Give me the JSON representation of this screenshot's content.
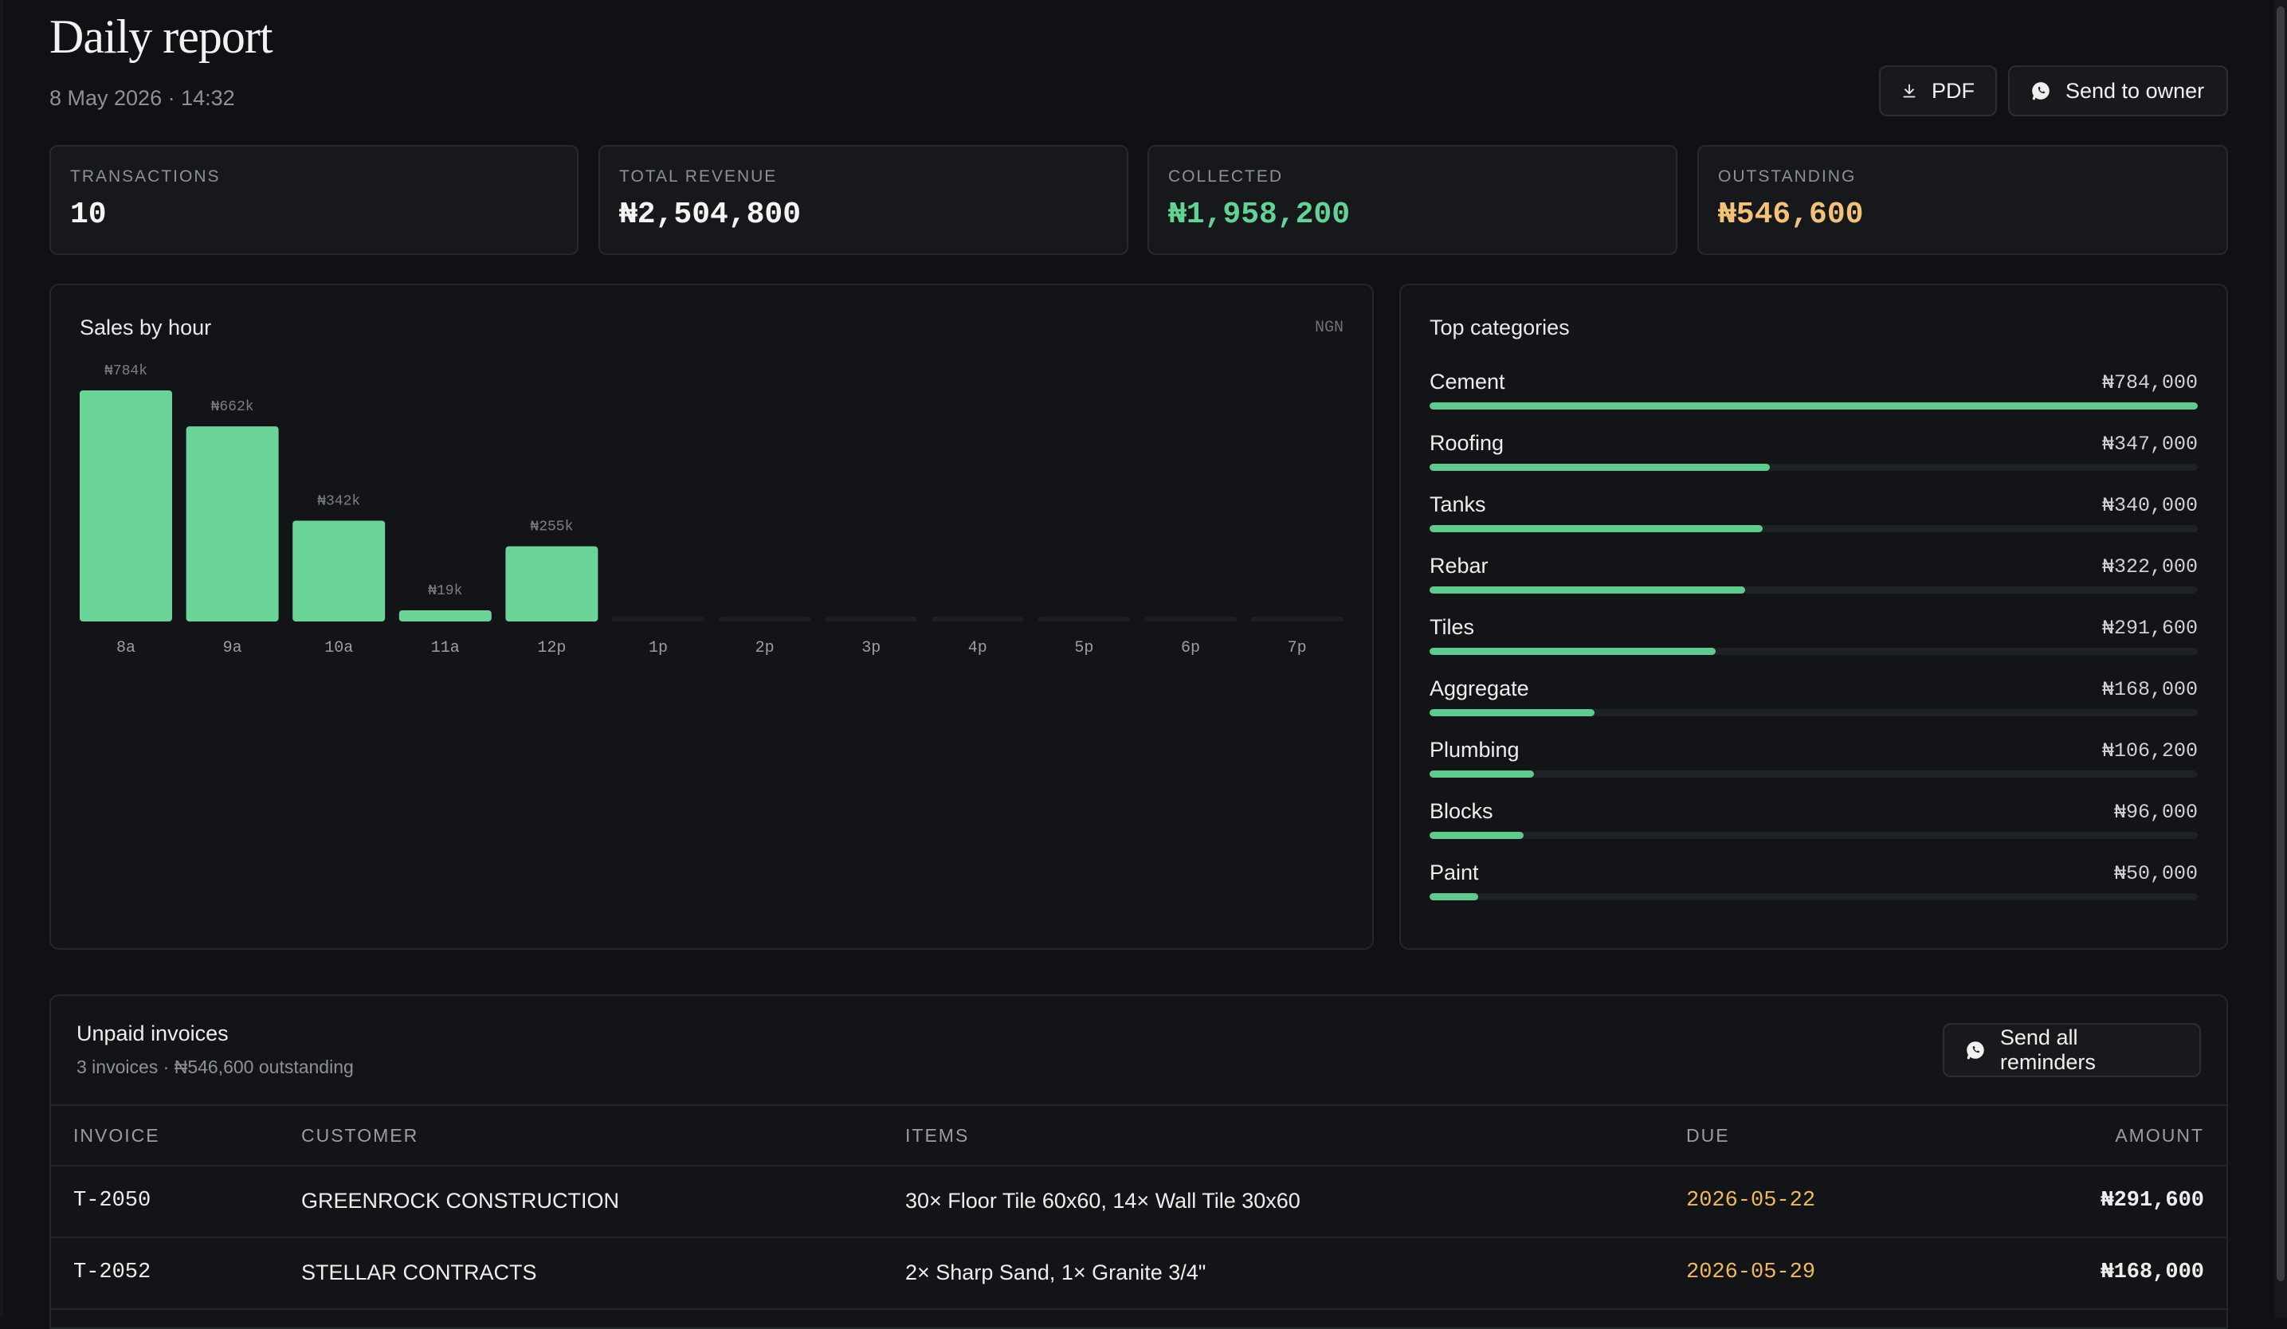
{
  "header": {
    "title": "Daily report",
    "subtitle": "8 May 2026 · 14:32",
    "pdf_label": "PDF",
    "send_label": "Send to owner"
  },
  "kpis": [
    {
      "label": "TRANSACTIONS",
      "value": "10"
    },
    {
      "label": "TOTAL REVENUE",
      "value": "₦2,504,800"
    },
    {
      "label": "COLLECTED",
      "value": "₦1,958,200"
    },
    {
      "label": "OUTSTANDING",
      "value": "₦546,600"
    }
  ],
  "colors": {
    "bar": "#6bd498",
    "bar_empty": "#1c1f23",
    "collected": "#63d294",
    "outstanding": "#f2c27a"
  },
  "sales": {
    "title": "Sales by hour",
    "currency": "NGN"
  },
  "chart_data": {
    "type": "bar",
    "title": "Sales by hour",
    "categories": [
      "8a",
      "9a",
      "10a",
      "11a",
      "12p",
      "1p",
      "2p",
      "3p",
      "4p",
      "5p",
      "6p",
      "7p"
    ],
    "values": [
      784000,
      662000,
      342000,
      19000,
      255000,
      0,
      0,
      0,
      0,
      0,
      0,
      0
    ],
    "data_labels": [
      "₦784k",
      "₦662k",
      "₦342k",
      "₦19k",
      "₦255k",
      "",
      "",
      "",
      "",
      "",
      "",
      ""
    ],
    "xlabel": "",
    "ylabel": "",
    "ylim": [
      0,
      784000
    ],
    "grid": false
  },
  "categories": {
    "title": "Top categories",
    "items": [
      {
        "name": "Cement",
        "value": "₦784,000",
        "amount": 784000
      },
      {
        "name": "Roofing",
        "value": "₦347,000",
        "amount": 347000
      },
      {
        "name": "Tanks",
        "value": "₦340,000",
        "amount": 340000
      },
      {
        "name": "Rebar",
        "value": "₦322,000",
        "amount": 322000
      },
      {
        "name": "Tiles",
        "value": "₦291,600",
        "amount": 291600
      },
      {
        "name": "Aggregate",
        "value": "₦168,000",
        "amount": 168000
      },
      {
        "name": "Plumbing",
        "value": "₦106,200",
        "amount": 106200
      },
      {
        "name": "Blocks",
        "value": "₦96,000",
        "amount": 96000
      },
      {
        "name": "Paint",
        "value": "₦50,000",
        "amount": 50000
      }
    ]
  },
  "unpaid": {
    "title": "Unpaid invoices",
    "subtitle": "3 invoices · ₦546,600 outstanding",
    "reminders_label": "Send all reminders",
    "columns": [
      "INVOICE",
      "CUSTOMER",
      "ITEMS",
      "DUE",
      "AMOUNT"
    ],
    "rows": [
      {
        "invoice": "T-2050",
        "customer": "GREENROCK CONSTRUCTION",
        "items": "30× Floor Tile 60x60, 14× Wall Tile 30x60",
        "due": "2026-05-22",
        "amount": "₦291,600"
      },
      {
        "invoice": "T-2052",
        "customer": "STELLAR CONTRACTS",
        "items": "2× Sharp Sand, 1× Granite 3/4\"",
        "due": "2026-05-29",
        "amount": "₦168,000"
      }
    ]
  }
}
